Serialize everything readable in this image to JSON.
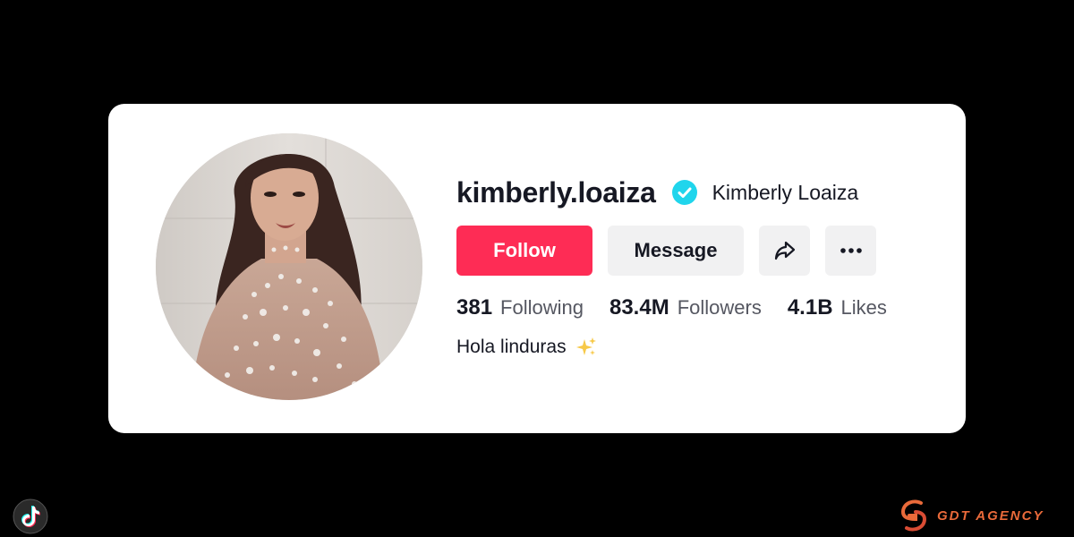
{
  "profile": {
    "username": "kimberly.loaiza",
    "display_name": "Kimberly Loaiza",
    "verified": true,
    "bio": "Hola linduras",
    "bio_emoji": "sparkles-icon"
  },
  "actions": {
    "follow_label": "Follow",
    "message_label": "Message",
    "share_icon": "share-icon",
    "more_icon": "more-icon"
  },
  "stats": [
    {
      "value": "381",
      "label": "Following"
    },
    {
      "value": "83.4M",
      "label": "Followers"
    },
    {
      "value": "4.1B",
      "label": "Likes"
    }
  ],
  "watermark": {
    "brand": "GDT AGENCY"
  },
  "colors": {
    "follow": "#fe2c55",
    "verified": "#20d5ec",
    "background": "#000000",
    "card": "#ffffff"
  }
}
